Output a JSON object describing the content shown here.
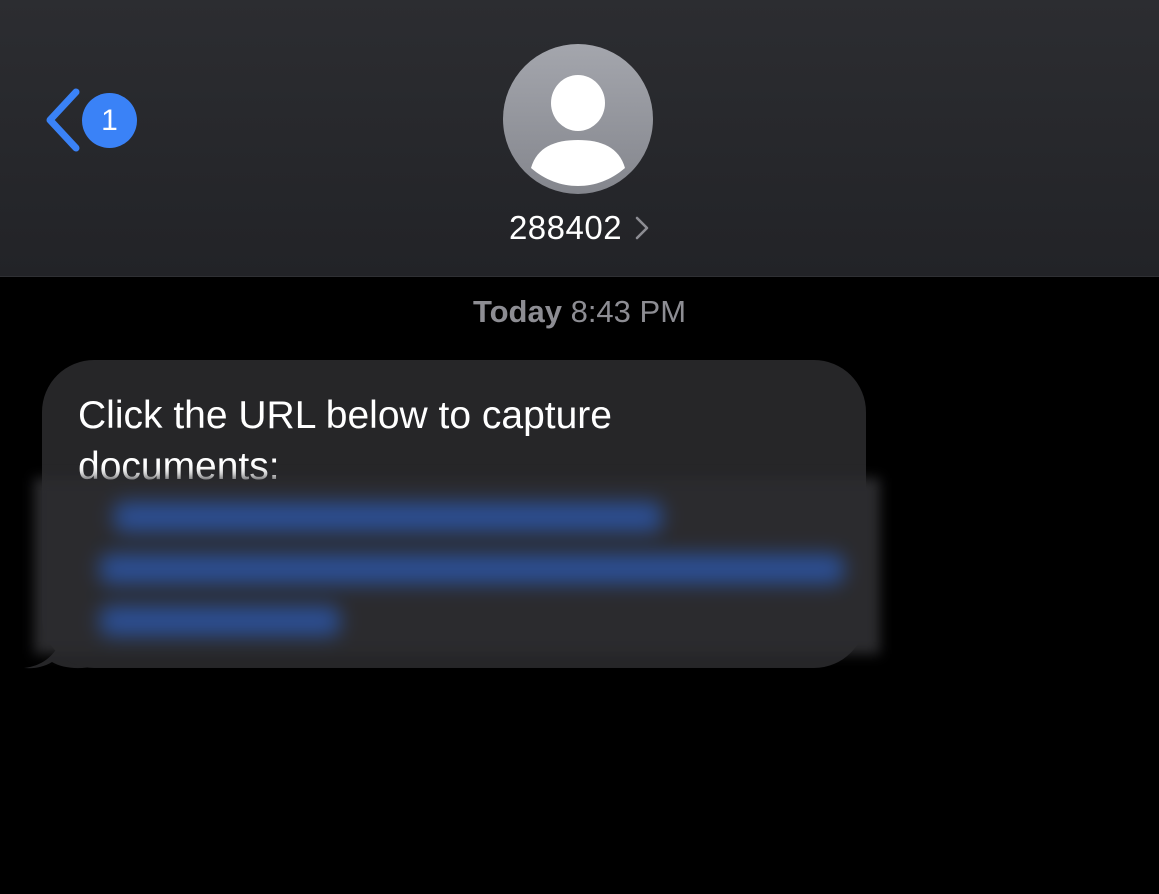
{
  "header": {
    "back_badge_count": "1",
    "contact_name": "288402",
    "icons": {
      "back": "chevron-left-icon",
      "avatar": "person-icon",
      "contact_detail": "chevron-right-icon"
    }
  },
  "conversation": {
    "timestamp_day": "Today",
    "timestamp_time": "8:43 PM",
    "messages": [
      {
        "direction": "incoming",
        "text": "Click the URL below to capture documents:",
        "link_redacted": true
      }
    ]
  },
  "colors": {
    "accent": "#3a82f7",
    "header_bg": "#2c2d31",
    "background": "#000000",
    "bubble_incoming": "#262628",
    "timestamp_text": "#8d8d93"
  }
}
